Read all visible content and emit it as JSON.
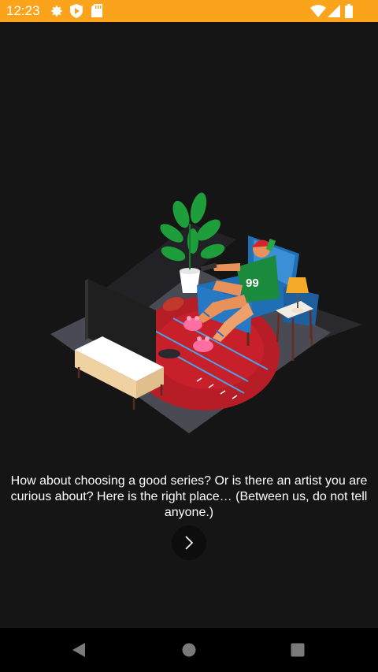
{
  "status_bar": {
    "time": "12:23",
    "background": "#FAA31B",
    "left_icons": [
      "gear-icon",
      "shield-play-icon",
      "sd-card-icon"
    ],
    "right_icons": [
      "wifi-icon",
      "cell-signal-icon",
      "battery-icon"
    ]
  },
  "onboarding": {
    "illustration_icon": "living-room-fan-illustration",
    "jersey_number": "99",
    "message": "How about choosing a good series? Or is there an artist you are curious about? Here is the right place… (Between us, do not tell anyone.)",
    "next_icon": "chevron-right-icon"
  },
  "nav_bar": {
    "items": [
      "back-icon",
      "home-icon",
      "recents-icon"
    ]
  }
}
